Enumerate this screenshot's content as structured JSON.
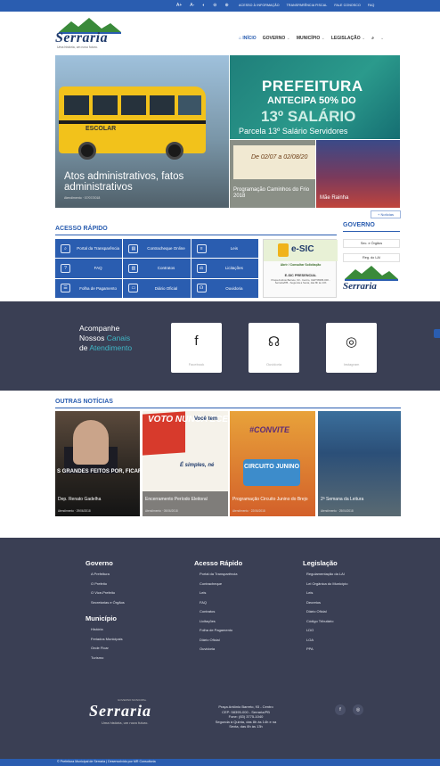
{
  "colors": {
    "primary": "#2a5db0",
    "dark": "#3a3f54",
    "accent": "#3fb7c6"
  },
  "topbar": {
    "accessibility": [
      "A+",
      "A-",
      "◐",
      "⊖",
      "⊕"
    ],
    "links": [
      "ACESSO À INFORMAÇÃO",
      "TRANSPARÊNCIA FISCAL",
      "FALE CONOSCO",
      "FAQ"
    ]
  },
  "logo": {
    "name": "Serraria",
    "tagline": "Uma história, um novo futuro."
  },
  "nav": {
    "items": [
      "INÍCIO",
      "GOVERNO",
      "MUNICÍPIO",
      "LEGISLAÇÃO"
    ]
  },
  "hero": {
    "main": {
      "bus_text": "ESCOLAR",
      "caption": "Atos administrativos, fatos administrativos",
      "meta": "Atendimento · 07/07/2018"
    },
    "promo": {
      "line1": "PREFEITURA",
      "line2": "ANTECIPA 50% DO",
      "line3": "13º SALÁRIO",
      "caption": "Parcela 13º Salário Servidores"
    },
    "s1": {
      "dates": "De 02/07 a 02/08/20",
      "caption": "Programação Caminhos do Frio 2018"
    },
    "s2": {
      "caption": "Mãe Rainha"
    },
    "more": "+ Notícias"
  },
  "acesso": {
    "title": "ACESSO RÁPIDO",
    "tiles": [
      {
        "label": "Portal da Transparência",
        "icon": "⌕"
      },
      {
        "label": "Contracheque Online",
        "icon": "▤"
      },
      {
        "label": "Leis",
        "icon": "≡"
      },
      {
        "label": "FAQ",
        "icon": "?"
      },
      {
        "label": "Contratos",
        "icon": "▥"
      },
      {
        "label": "Licitações",
        "icon": "⚖"
      },
      {
        "label": "Folha de Pagamento",
        "icon": "☰"
      },
      {
        "label": "Diário Oficial",
        "icon": "▭"
      },
      {
        "label": "Ouvidoria",
        "icon": "☊"
      }
    ],
    "esic": {
      "title": "e-SIC",
      "sub": "Abrir / Consultar Solicitação",
      "pres": "E-SIC PRESENCIAL",
      "addr": "Praça Antônio Barreto, 93 - Centro, CEP 58395-000 - Serraria/PB - Segunda a Sexta, das 8h às 13h"
    }
  },
  "governo": {
    "title": "GOVERNO",
    "links": [
      "Sec. e Órgãos",
      "Reg. do LAI"
    ],
    "logo_name": "Serraria"
  },
  "follow": {
    "line1": "Acompanhe",
    "line2a": "Nossos ",
    "line2b": "Canais",
    "line3a": "de ",
    "line3b": "Atendimento",
    "cards": [
      {
        "label": "Facebook",
        "glyph": "f"
      },
      {
        "label": "Ouvidoria",
        "glyph": "☊"
      },
      {
        "label": "Instagram",
        "glyph": "◎"
      }
    ]
  },
  "outras": {
    "title": "OUTRAS NOTÍCIAS",
    "items": [
      {
        "overlay": "S GRANDES FEITOS POR, FICARÃO NA HISTÓRIA, RÉM O ABRAÇO FRATERNO, FOI SERVIÇO ESCARÇOU MAI",
        "caption": "Dep. Renato Gadelha",
        "meta": "Atendimento · 29/06/2018"
      },
      {
        "vote": "VOTO NUNCA ECE",
        "voce": "Você tem",
        "simples": "É simples, né",
        "caption": "Encerramento Período Eleitoral",
        "meta": "Atendimento · 05/06/2018"
      },
      {
        "convite": "#CONVITE",
        "circuito": "CIRCUITO JUNINO",
        "caption": "Programação Circuito Junino do Brejo",
        "meta": "Atendimento · 22/06/2018"
      },
      {
        "caption": "2ª Semana da Leitura",
        "meta": "Atendimento · 25/04/2018"
      }
    ]
  },
  "footer": {
    "governo": {
      "title": "Governo",
      "items": [
        "A Prefeitura",
        "O Prefeito",
        "O Vice-Prefeito",
        "Secretarias e Órgãos"
      ]
    },
    "municipio": {
      "title": "Município",
      "items": [
        "História",
        "Feriados Municipais",
        "Onde Ficar",
        "Turismo"
      ]
    },
    "acesso": {
      "title": "Acesso Rápido",
      "items": [
        "Portal da Transparência",
        "Contracheque",
        "Leis",
        "FAQ",
        "Contratos",
        "Licitações",
        "Folha de Pagamento",
        "Diário Oficial",
        "Ouvidoria"
      ]
    },
    "legislacao": {
      "title": "Legislação",
      "items": [
        "Regulamentação da LAI",
        "Lei Orgânica do Município",
        "Leis",
        "Decretos",
        "Diário Oficial",
        "Código Tributário",
        "LDO",
        "LOA",
        "PPA"
      ]
    },
    "logo": {
      "small": "GOVERNO MUNICIPAL",
      "name": "Serraria",
      "tagline": "Uma história, um novo futuro."
    },
    "address": [
      "Praça Antônio Barreto, 93 - Centro",
      "CEP: 58395-000 - Serraria/PB",
      "Fone: (83) 3775-1040",
      "Segunda à Quinta, das 8h às 14h e na",
      "Sexta, das 8h às 13h"
    ],
    "social": [
      "f",
      "◎"
    ],
    "copyright": "© Prefeitura Municipal de Serraria | Desenvolvido por MR Consultoria"
  }
}
